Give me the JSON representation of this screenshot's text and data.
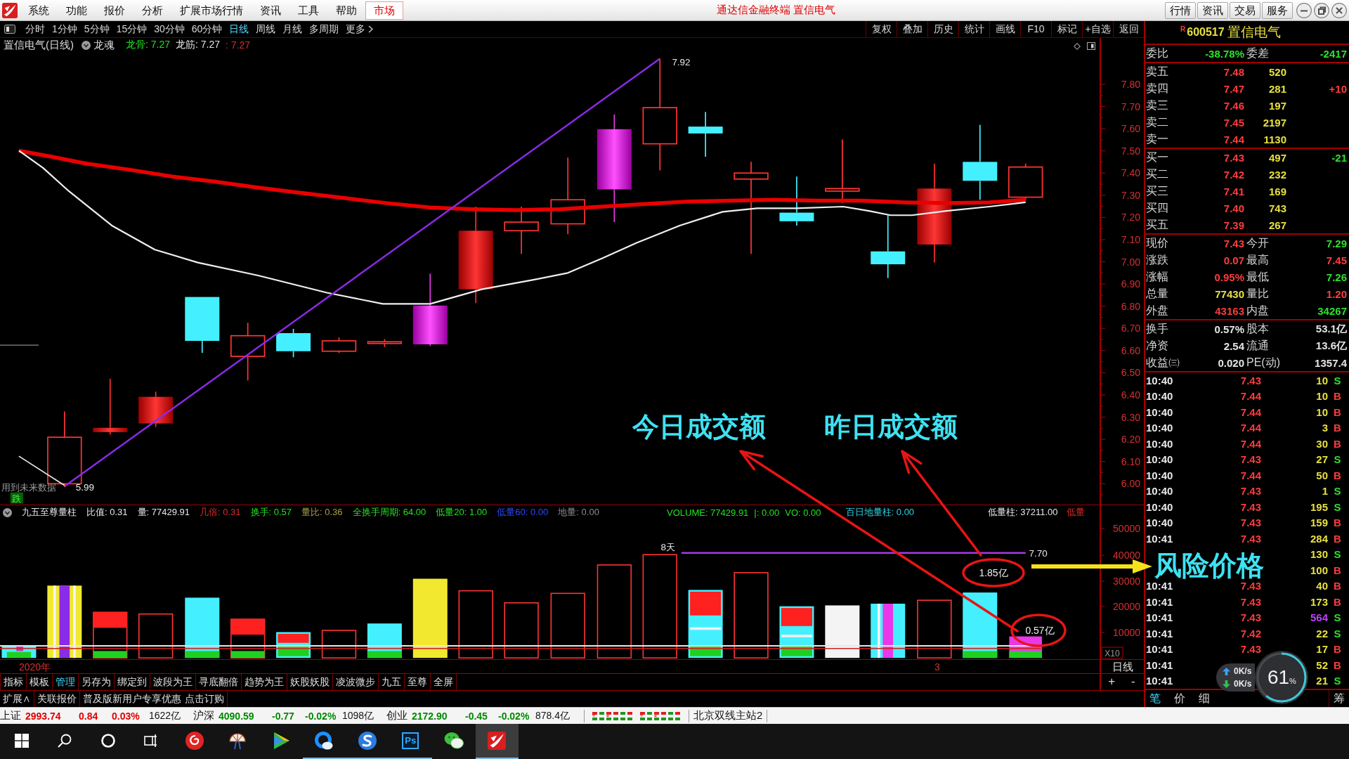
{
  "menubar": {
    "menus": [
      {
        "label": "系统",
        "selected": false
      },
      {
        "label": "功能",
        "selected": false
      },
      {
        "label": "报价",
        "selected": false
      },
      {
        "label": "分析",
        "selected": false
      },
      {
        "label": "扩展市场行情",
        "selected": false
      },
      {
        "label": "资讯",
        "selected": false
      },
      {
        "label": "工具",
        "selected": false
      },
      {
        "label": "帮助",
        "selected": false
      },
      {
        "label": "市场",
        "selected": true
      }
    ],
    "title": "通达信金融终端 置信电气",
    "buttons": [
      "行情",
      "资讯",
      "交易",
      "服务"
    ]
  },
  "toolbar": {
    "periods": [
      {
        "label": "分时",
        "selected": false
      },
      {
        "label": "1分钟",
        "selected": false
      },
      {
        "label": "5分钟",
        "selected": false
      },
      {
        "label": "15分钟",
        "selected": false
      },
      {
        "label": "30分钟",
        "selected": false
      },
      {
        "label": "60分钟",
        "selected": false
      },
      {
        "label": "日线",
        "selected": true
      },
      {
        "label": "周线",
        "selected": false
      },
      {
        "label": "月线",
        "selected": false
      },
      {
        "label": "多周期",
        "selected": false
      },
      {
        "label": "更多",
        "selected": false
      }
    ],
    "tools": [
      "复权",
      "叠加",
      "历史",
      "统计",
      "画线",
      "F10",
      "标记",
      "+自选",
      "返回"
    ]
  },
  "price_chart": {
    "title": "置信电气(日线)",
    "indicator": "龙魂",
    "readouts": [
      {
        "text": "龙骨: 7.27",
        "color": "#22e022"
      },
      {
        "text": "龙筋: 7.27",
        "color": "#e6e6e6"
      },
      {
        "text": ": 7.27",
        "color": "#e02828"
      }
    ],
    "peak_label": "7.92",
    "low_label": "5.99",
    "note": "用到未来数据",
    "signal": "跌",
    "axis": [
      "7.80",
      "7.70",
      "7.60",
      "7.50",
      "7.40",
      "7.30",
      "7.20",
      "7.10",
      "7.00",
      "6.90",
      "6.80",
      "6.70",
      "6.60",
      "6.50",
      "6.40",
      "6.30",
      "6.20",
      "6.10",
      "6.00"
    ]
  },
  "volume_chart": {
    "groups": [
      {
        "readouts": [
          {
            "text": "九五至尊量柱",
            "color": "#e6e6e6"
          },
          {
            "text": "比值: 0.31",
            "color": "#e6e6e6"
          },
          {
            "text": "量: 77429.91",
            "color": "#e6e6e6"
          },
          {
            "text": "几倍: 0.31",
            "color": "#e02828"
          },
          {
            "text": "换手: 0.57",
            "color": "#22e022"
          },
          {
            "text": "量比: 0.36",
            "color": "#a8a040"
          },
          {
            "text": "全换手周期: 64.00",
            "color": "#22e022"
          },
          {
            "text": "低量20: 1.00",
            "color": "#22e022"
          },
          {
            "text": "低量60: 0.00",
            "color": "#2848ff"
          },
          {
            "text": "地量: 0.00",
            "color": "#8a8a8a"
          }
        ]
      },
      {
        "readouts": [
          {
            "text": "VOLUME: 77429.91",
            "color": "#22e022"
          },
          {
            "text": "|: 0.00",
            "color": "#22e022"
          },
          {
            "text": "VO: 0.00",
            "color": "#22e022"
          },
          {
            "text": "百日地量柱: 0.00",
            "color": "#30d0e0"
          }
        ]
      },
      {
        "readouts": [
          {
            "text": "低量柱: 37211.00",
            "color": "#e6e6e6"
          },
          {
            "text": "低量",
            "color": "#e02828"
          }
        ]
      }
    ],
    "span_label": "8天",
    "level_label": "7.70",
    "axis": [
      "50000",
      "40000",
      "30000",
      "20000",
      "10000"
    ],
    "scale": "X10"
  },
  "date_axis": {
    "labels": [
      "2020年",
      "3"
    ]
  },
  "axis_controls": {
    "period": "日线",
    "buttons": [
      "+",
      "-"
    ]
  },
  "annotations": {
    "today": "今日成交额",
    "yesterday": "昨日成交额",
    "amounts": [
      "1.85亿",
      "0.57亿"
    ],
    "risk": "风险价格"
  },
  "formula_tabs": [
    {
      "label": "指标",
      "selected": false
    },
    {
      "label": "模板",
      "selected": false
    },
    {
      "label": "管理",
      "selected": true
    },
    {
      "label": "另存为",
      "selected": false
    },
    {
      "label": "绑定到",
      "selected": false
    },
    {
      "label": "波段为王",
      "selected": false
    },
    {
      "label": "寻底翻倍",
      "selected": false
    },
    {
      "label": "趋势为王",
      "selected": false
    },
    {
      "label": "妖股妖股",
      "selected": false
    },
    {
      "label": "凌波微步",
      "selected": false
    },
    {
      "label": "九五",
      "selected": false
    },
    {
      "label": "至尊",
      "selected": false
    },
    {
      "label": "全屏",
      "selected": false
    }
  ],
  "extension_bar": {
    "items": [
      "扩展∧",
      "关联报价"
    ],
    "promo": "普及版新用户专享优惠",
    "promo_link": "点击订购"
  },
  "quote_panel": {
    "header": {
      "flag": "R",
      "code": "600517",
      "name": "置信电气"
    },
    "ratio": [
      {
        "label": "委比",
        "value": "-38.78%",
        "color": "#2ee02e"
      },
      {
        "label": "委差",
        "value": "-2417",
        "color": "#2ee02e"
      }
    ],
    "asks": [
      {
        "label": "卖五",
        "price": "7.48",
        "volume": "520"
      },
      {
        "label": "卖四",
        "price": "7.47",
        "volume": "281",
        "change": {
          "text": "+10",
          "color": "#ff3c3c"
        }
      },
      {
        "label": "卖三",
        "price": "7.46",
        "volume": "197"
      },
      {
        "label": "卖二",
        "price": "7.45",
        "volume": "2197"
      },
      {
        "label": "卖一",
        "price": "7.44",
        "volume": "1130"
      }
    ],
    "bids": [
      {
        "label": "买一",
        "price": "7.43",
        "volume": "497",
        "change": {
          "text": "-21",
          "color": "#2ee02e"
        }
      },
      {
        "label": "买二",
        "price": "7.42",
        "volume": "232"
      },
      {
        "label": "买三",
        "price": "7.41",
        "volume": "169"
      },
      {
        "label": "买四",
        "price": "7.40",
        "volume": "743"
      },
      {
        "label": "买五",
        "price": "7.39",
        "volume": "267"
      }
    ],
    "stats": [
      {
        "label": "现价",
        "value": "7.43",
        "color": "#ff3c3c"
      },
      {
        "label": "今开",
        "value": "7.29",
        "color": "#2ee02e"
      },
      {
        "label": "涨跌",
        "value": "0.07",
        "color": "#ff3c3c"
      },
      {
        "label": "最高",
        "value": "7.45",
        "color": "#ff3c3c"
      },
      {
        "label": "涨幅",
        "value": "0.95%",
        "color": "#ff3c3c"
      },
      {
        "label": "最低",
        "value": "7.26",
        "color": "#2ee02e"
      },
      {
        "label": "总量",
        "value": "77430",
        "color": "#e6e040"
      },
      {
        "label": "量比",
        "value": "1.20",
        "color": "#ff3c3c"
      },
      {
        "label": "外盘",
        "value": "43163",
        "color": "#ff3c3c"
      },
      {
        "label": "内盘",
        "value": "34267",
        "color": "#2ee02e"
      }
    ],
    "fundamentals": [
      {
        "label": "换手",
        "value": "0.57%"
      },
      {
        "label": "股本",
        "value": "53.1亿"
      },
      {
        "label": "净资",
        "value": "2.54"
      },
      {
        "label": "流通",
        "value": "13.6亿"
      },
      {
        "label": "收益㈢",
        "value": "0.020"
      },
      {
        "label": "PE(动)",
        "value": "1357.4"
      }
    ],
    "ticks": [
      {
        "time": "10:40",
        "price": "7.43",
        "volume": "10",
        "side": "S",
        "kind": "sell",
        "large": false
      },
      {
        "time": "10:40",
        "price": "7.44",
        "volume": "10",
        "side": "B",
        "kind": "buy",
        "large": false
      },
      {
        "time": "10:40",
        "price": "7.44",
        "volume": "10",
        "side": "B",
        "kind": "buy",
        "large": false
      },
      {
        "time": "10:40",
        "price": "7.44",
        "volume": "3",
        "side": "B",
        "kind": "buy",
        "large": false
      },
      {
        "time": "10:40",
        "price": "7.44",
        "volume": "30",
        "side": "B",
        "kind": "buy",
        "large": false
      },
      {
        "time": "10:40",
        "price": "7.43",
        "volume": "27",
        "side": "S",
        "kind": "sell",
        "large": false
      },
      {
        "time": "10:40",
        "price": "7.44",
        "volume": "50",
        "side": "B",
        "kind": "buy",
        "large": false
      },
      {
        "time": "10:40",
        "price": "7.43",
        "volume": "1",
        "side": "S",
        "kind": "sell",
        "large": false
      },
      {
        "time": "10:40",
        "price": "7.43",
        "volume": "195",
        "side": "S",
        "kind": "sell",
        "large": false
      },
      {
        "time": "10:40",
        "price": "7.43",
        "volume": "159",
        "side": "B",
        "kind": "buy",
        "large": false
      },
      {
        "time": "10:41",
        "price": "7.43",
        "volume": "284",
        "side": "B",
        "kind": "buy",
        "large": false
      },
      {
        "volume": "130",
        "side": "S",
        "kind": "sell",
        "large": false
      },
      {
        "volume": "100",
        "side": "B",
        "kind": "buy",
        "large": false
      },
      {
        "time": "10:41",
        "price": "7.43",
        "volume": "40",
        "side": "B",
        "kind": "buy",
        "large": false
      },
      {
        "time": "10:41",
        "price": "7.43",
        "volume": "173",
        "side": "B",
        "kind": "buy",
        "large": false
      },
      {
        "time": "10:41",
        "price": "7.43",
        "volume": "564",
        "side": "S",
        "kind": "sell",
        "large": true
      },
      {
        "time": "10:41",
        "price": "7.42",
        "volume": "22",
        "side": "S",
        "kind": "sell",
        "large": false
      },
      {
        "time": "10:41",
        "price": "7.43",
        "volume": "17",
        "side": "B",
        "kind": "buy",
        "large": false
      },
      {
        "time": "10:41",
        "volume": "52",
        "side": "B",
        "kind": "buy",
        "large": false
      },
      {
        "time": "10:41",
        "volume": "21",
        "side": "S",
        "kind": "sell",
        "large": false
      }
    ],
    "tabs": [
      {
        "label": "笔",
        "selected": true
      },
      {
        "label": "价",
        "selected": false
      },
      {
        "label": "细",
        "selected": false
      },
      {
        "label": "筹",
        "selected": false
      }
    ]
  },
  "speed_widget": {
    "upload": "0K/s",
    "download": "0K/s",
    "load": "61$_{%}$",
    "level": 0.61
  },
  "status_bar": {
    "indices": [
      {
        "name": "上证",
        "value": "2993.74",
        "change": "0.84",
        "percent": "0.03%",
        "amount": "1622亿",
        "rising": true
      },
      {
        "name": "沪深",
        "value": "4090.59",
        "change": "-0.77",
        "percent": "-0.02%",
        "amount": "1098亿",
        "rising": false
      },
      {
        "name": "创业",
        "value": "2172.90",
        "change": "-0.45",
        "percent": "-0.02%",
        "amount": "878.4亿",
        "rising": false
      }
    ],
    "server": "北京双线主站2"
  },
  "taskbar": {
    "items": [
      {
        "kind": "start",
        "running": false,
        "selected": false
      },
      {
        "kind": "search",
        "running": false,
        "selected": false
      },
      {
        "kind": "cortana",
        "running": false,
        "selected": false
      },
      {
        "kind": "task-view",
        "running": false,
        "selected": false
      },
      {
        "kind": "music",
        "running": false,
        "selected": false
      },
      {
        "kind": "snip",
        "running": false,
        "selected": false
      },
      {
        "kind": "video",
        "running": false,
        "selected": false
      },
      {
        "kind": "browser",
        "running": true,
        "selected": false
      },
      {
        "kind": "input",
        "running": true,
        "selected": false
      },
      {
        "kind": "ps",
        "label": "Ps",
        "running": true,
        "selected": false
      },
      {
        "kind": "chat",
        "running": false,
        "selected": false
      },
      {
        "kind": "tdx",
        "running": true,
        "selected": true
      }
    ]
  }
}
